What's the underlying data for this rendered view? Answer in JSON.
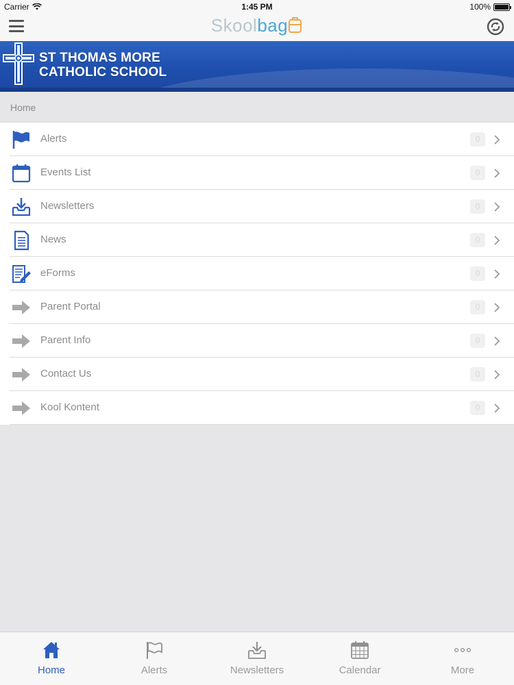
{
  "status_bar": {
    "carrier": "Carrier",
    "time": "1:45 PM",
    "battery": "100%",
    "battery_level": 1.0
  },
  "nav_bar": {
    "brand_part1": "Skool",
    "brand_part2": "bag",
    "menu_icon": "hamburger-icon",
    "sync_icon": "sync-icon"
  },
  "banner": {
    "line1": "ST THOMAS MORE",
    "line2": "CATHOLIC SCHOOL",
    "logo": "cross-logo"
  },
  "breadcrumb": "Home",
  "menu_items": [
    {
      "label": "Alerts",
      "badge": "0",
      "icon": "flag-icon"
    },
    {
      "label": "Events List",
      "badge": "0",
      "icon": "calendar-icon"
    },
    {
      "label": "Newsletters",
      "badge": "0",
      "icon": "inbox-download-icon"
    },
    {
      "label": "News",
      "badge": "0",
      "icon": "document-icon"
    },
    {
      "label": "eForms",
      "badge": "0",
      "icon": "form-pen-icon"
    },
    {
      "label": "Parent Portal",
      "badge": "0",
      "icon": "arrow-right-icon"
    },
    {
      "label": "Parent Info",
      "badge": "0",
      "icon": "arrow-right-icon"
    },
    {
      "label": "Contact Us",
      "badge": "0",
      "icon": "arrow-right-icon"
    },
    {
      "label": "Kool Kontent",
      "badge": "0",
      "icon": "arrow-right-icon"
    }
  ],
  "tabs": [
    {
      "label": "Home",
      "icon": "home-icon",
      "active": true
    },
    {
      "label": "Alerts",
      "icon": "flag-icon",
      "active": false
    },
    {
      "label": "Newsletters",
      "icon": "inbox-download-icon",
      "active": false
    },
    {
      "label": "Calendar",
      "icon": "calendar-grid-icon",
      "active": false
    },
    {
      "label": "More",
      "icon": "more-dots-icon",
      "active": false
    }
  ],
  "colors": {
    "accent_blue": "#2e5fbf",
    "banner_blue": "#1f4fae",
    "muted_text": "#8c8c8c",
    "brand_teal": "#4ba8d9",
    "brand_orange": "#f0a64b"
  }
}
